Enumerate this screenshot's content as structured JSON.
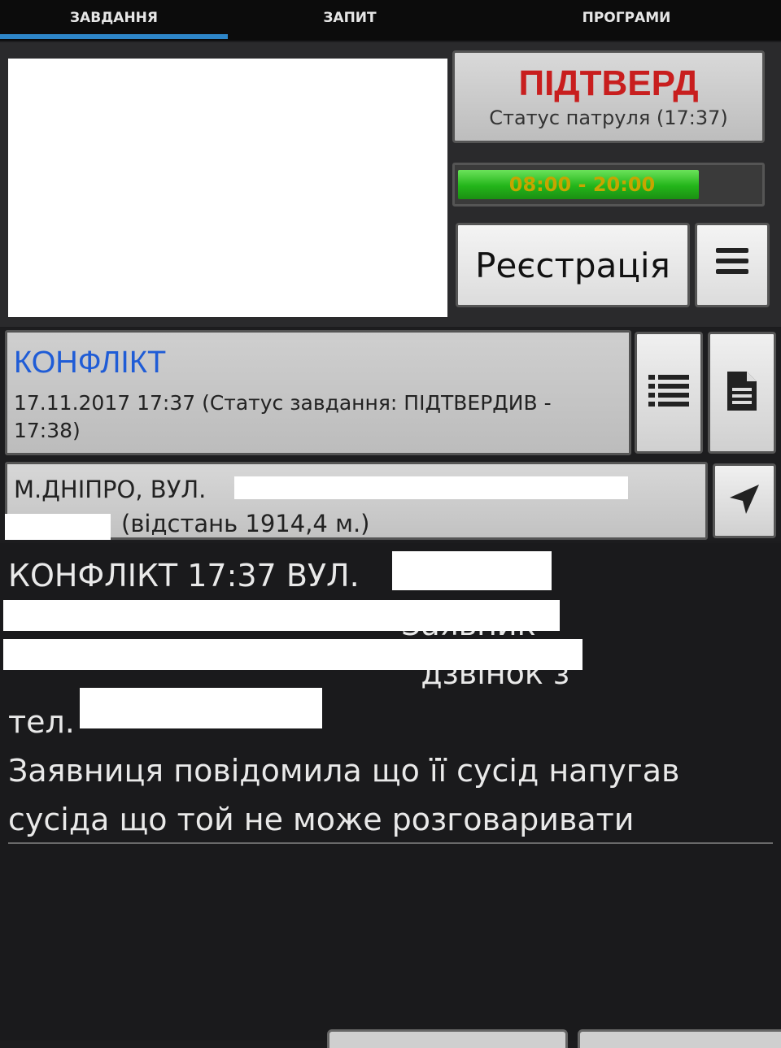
{
  "tabs": [
    {
      "label": "ЗАВДАННЯ",
      "active": true
    },
    {
      "label": "ЗАПИТ",
      "active": false
    },
    {
      "label": "ПРОГРАМИ",
      "active": false
    }
  ],
  "status": {
    "title": "ПІДТВЕРД",
    "subtitle": "Статус патруля (17:37)"
  },
  "shift": {
    "time_range": "08:00 - 20:00",
    "progress_fraction": 0.8
  },
  "registration_label": "Реєстрація",
  "task": {
    "type": "КОНФЛІКТ",
    "info": "17.11.2017 17:37 (Статус завдання: ПІДТВЕРДИВ - 17:38)"
  },
  "address": {
    "line1": "М.ДНІПРО, ВУЛ.",
    "distance": "(відстань 1914,4 м.)"
  },
  "message": {
    "text": "КОНФЛІКТ 17:37 ВУЛ.\n                                        Заявник\n                                          дзвінок з\nтел.\nЗаявниця повідомила що її сусід напугав\nсусіда що той не може розговаривати"
  },
  "colors": {
    "tab_active_underline": "#2e86c9",
    "status_title": "#c81e1e",
    "task_type": "#1f5cd6",
    "shift_fill": "#23b51a",
    "shift_text": "#c6a500"
  },
  "icons": {
    "menu": "hamburger-icon",
    "list": "list-icon",
    "document": "document-icon",
    "navigate": "navigation-arrow-icon"
  }
}
